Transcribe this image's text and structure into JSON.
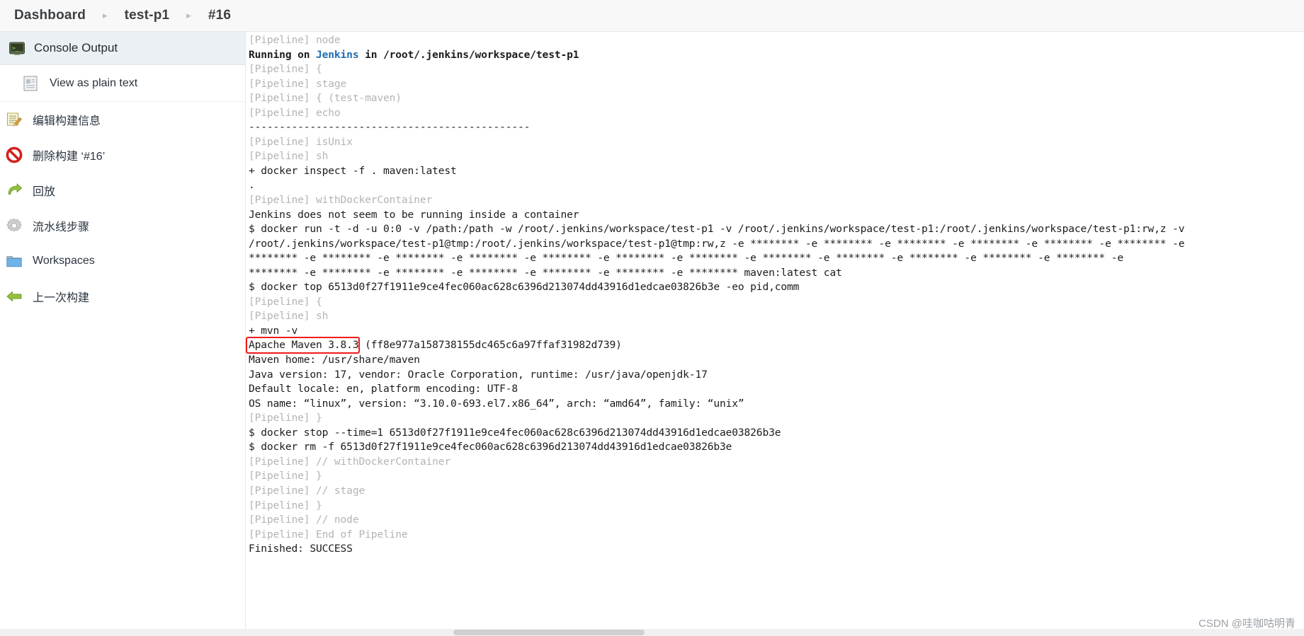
{
  "breadcrumb": {
    "items": [
      {
        "label": "Dashboard"
      },
      {
        "label": "test-p1"
      },
      {
        "label": "#16"
      }
    ],
    "separator": "▸"
  },
  "sidebar": {
    "active": {
      "label": "Console Output",
      "icon": "terminal-icon"
    },
    "sub": {
      "label": "View as plain text",
      "icon": "document-icon"
    },
    "items": [
      {
        "label": "编辑构建信息",
        "icon": "edit-note-icon"
      },
      {
        "label": "删除构建 ‘#16’",
        "icon": "delete-forbidden-icon"
      },
      {
        "label": "回放",
        "icon": "replay-arrow-icon"
      },
      {
        "label": "流水线步骤",
        "icon": "gear-icon"
      },
      {
        "label": "Workspaces",
        "icon": "folder-icon"
      },
      {
        "label": "上一次构建",
        "icon": "back-arrow-icon"
      }
    ]
  },
  "console": {
    "lines": [
      {
        "prefix": "[Pipeline] ",
        "text": "node",
        "style": "pl"
      },
      {
        "segments": [
          {
            "t": "Running on ",
            "c": "b"
          },
          {
            "t": "Jenkins",
            "c": "lnk"
          },
          {
            "t": " in /root/.jenkins/workspace/test-p1",
            "c": "b"
          }
        ]
      },
      {
        "prefix": "[Pipeline] ",
        "text": "{",
        "style": "pl"
      },
      {
        "prefix": "[Pipeline] ",
        "text": "stage",
        "style": "pl"
      },
      {
        "prefix": "[Pipeline] ",
        "text": "{ (test-maven)",
        "style": "pl"
      },
      {
        "prefix": "[Pipeline] ",
        "text": "echo",
        "style": "pl"
      },
      {
        "text": "----------------------------------------------"
      },
      {
        "prefix": "[Pipeline] ",
        "text": "isUnix",
        "style": "pl"
      },
      {
        "prefix": "[Pipeline] ",
        "text": "sh",
        "style": "pl"
      },
      {
        "text": "+ docker inspect -f . maven:latest"
      },
      {
        "text": "."
      },
      {
        "prefix": "[Pipeline] ",
        "text": "withDockerContainer",
        "style": "pl"
      },
      {
        "text": "Jenkins does not seem to be running inside a container"
      },
      {
        "text": "$ docker run -t -d -u 0:0 -v /path:/path -w /root/.jenkins/workspace/test-p1 -v /root/.jenkins/workspace/test-p1:/root/.jenkins/workspace/test-p1:rw,z -v"
      },
      {
        "text": "/root/.jenkins/workspace/test-p1@tmp:/root/.jenkins/workspace/test-p1@tmp:rw,z -e ******** -e ******** -e ******** -e ******** -e ******** -e ******** -e"
      },
      {
        "text": "******** -e ******** -e ******** -e ******** -e ******** -e ******** -e ******** -e ******** -e ******** -e ******** -e ******** -e ******** -e"
      },
      {
        "text": "******** -e ******** -e ******** -e ******** -e ******** -e ******** -e ******** maven:latest cat"
      },
      {
        "text": "$ docker top 6513d0f27f1911e9ce4fec060ac628c6396d213074dd43916d1edcae03826b3e -eo pid,comm"
      },
      {
        "prefix": "[Pipeline] ",
        "text": "{",
        "style": "pl"
      },
      {
        "prefix": "[Pipeline] ",
        "text": "sh",
        "style": "pl"
      },
      {
        "text": "+ mvn -v"
      },
      {
        "text": "Apache Maven 3.8.3 (ff8e977a158738155dc465c6a97ffaf31982d739)",
        "highlight": true
      },
      {
        "text": "Maven home: /usr/share/maven"
      },
      {
        "text": "Java version: 17, vendor: Oracle Corporation, runtime: /usr/java/openjdk-17"
      },
      {
        "text": "Default locale: en, platform encoding: UTF-8"
      },
      {
        "text": "OS name: “linux”, version: “3.10.0-693.el7.x86_64”, arch: “amd64”, family: “unix”"
      },
      {
        "prefix": "[Pipeline] ",
        "text": "}",
        "style": "pl"
      },
      {
        "text": "$ docker stop --time=1 6513d0f27f1911e9ce4fec060ac628c6396d213074dd43916d1edcae03826b3e"
      },
      {
        "text": "$ docker rm -f 6513d0f27f1911e9ce4fec060ac628c6396d213074dd43916d1edcae03826b3e"
      },
      {
        "prefix": "[Pipeline] ",
        "text": "// withDockerContainer",
        "style": "pl"
      },
      {
        "prefix": "[Pipeline] ",
        "text": "}",
        "style": "pl"
      },
      {
        "prefix": "[Pipeline] ",
        "text": "// stage",
        "style": "pl"
      },
      {
        "prefix": "[Pipeline] ",
        "text": "}",
        "style": "pl"
      },
      {
        "prefix": "[Pipeline] ",
        "text": "// node",
        "style": "pl"
      },
      {
        "prefix": "[Pipeline] ",
        "text": "End of Pipeline",
        "style": "pl"
      },
      {
        "text": "Finished: SUCCESS"
      }
    ],
    "highlight_label": "Apache Maven 3.8.3"
  },
  "watermark": {
    "text": "CSDN @哇咖咕明青"
  },
  "colors": {
    "accent": "#1f6fb2",
    "highlight_box": "#f11a1a",
    "pipeline_gray": "#b4b4b4",
    "sidebar_active_bg": "#eaf0f3"
  }
}
